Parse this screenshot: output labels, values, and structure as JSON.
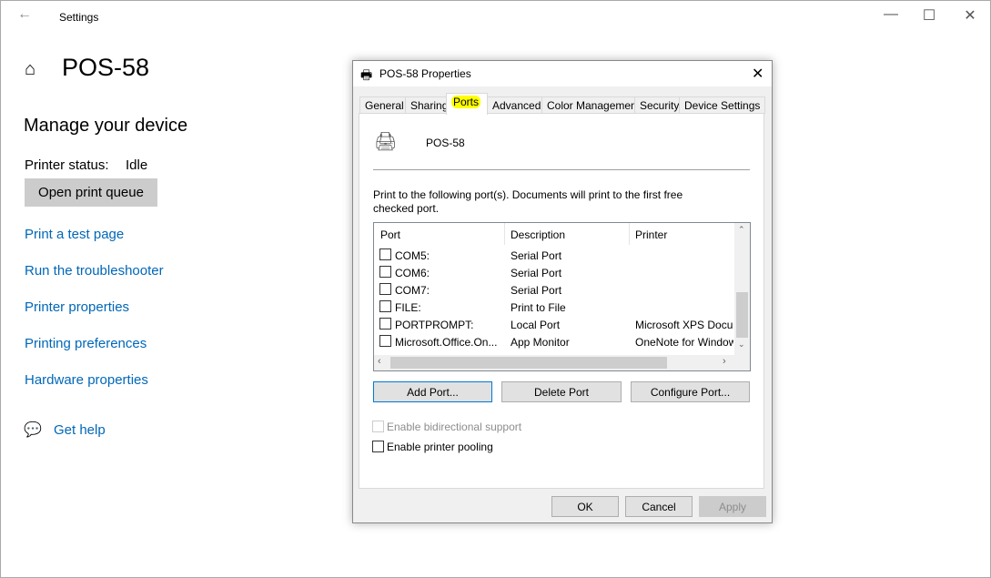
{
  "settings": {
    "title": "Settings",
    "device_name": "POS-58",
    "section_title": "Manage your device",
    "status_label": "Printer status:",
    "status_value": "Idle",
    "open_queue": "Open print queue",
    "links": [
      "Print a test page",
      "Run the troubleshooter",
      "Printer properties",
      "Printing preferences",
      "Hardware properties"
    ],
    "get_help": "Get help",
    "link_color": "#0067b8"
  },
  "dialog": {
    "title": "POS-58 Properties",
    "tabs": [
      "General",
      "Sharing",
      "Ports",
      "Advanced",
      "Color Management",
      "Security",
      "Device Settings"
    ],
    "active_tab": "Ports",
    "printer_name": "POS-58",
    "instructions": "Print to the following port(s). Documents will print to the first free checked port.",
    "columns": [
      "Port",
      "Description",
      "Printer"
    ],
    "rows": [
      {
        "port": "COM5:",
        "description": "Serial Port",
        "printer": ""
      },
      {
        "port": "COM6:",
        "description": "Serial Port",
        "printer": ""
      },
      {
        "port": "COM7:",
        "description": "Serial Port",
        "printer": ""
      },
      {
        "port": "FILE:",
        "description": "Print to File",
        "printer": ""
      },
      {
        "port": "PORTPROMPT:",
        "description": "Local Port",
        "printer": "Microsoft XPS Docur"
      },
      {
        "port": "Microsoft.Office.On...",
        "description": "App Monitor",
        "printer": "OneNote for Window"
      }
    ],
    "add_port": "Add Port...",
    "delete_port": "Delete Port",
    "configure_port": "Configure Port...",
    "bidi": "Enable bidirectional support",
    "pooling": "Enable printer pooling",
    "ok": "OK",
    "cancel": "Cancel",
    "apply": "Apply"
  }
}
